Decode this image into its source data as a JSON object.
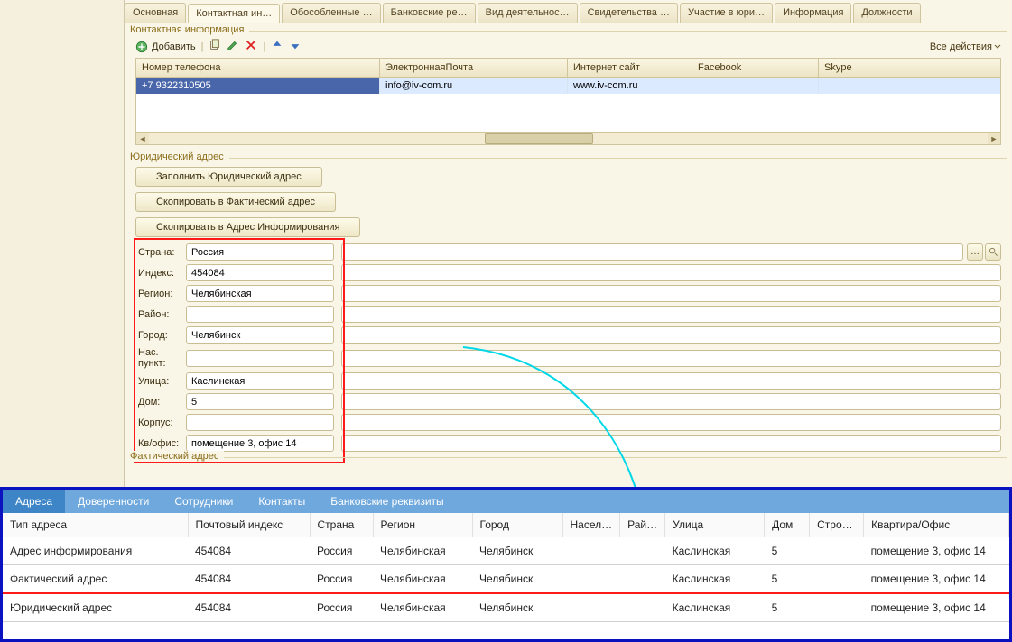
{
  "tabs": [
    "Основная",
    "Контактная ин…",
    "Обособленные …",
    "Банковские ре…",
    "Вид деятельнос…",
    "Свидетельства …",
    "Участие в юри…",
    "Информация",
    "Должности"
  ],
  "active_tab_index": 1,
  "contact_section_title": "Контактная информация",
  "toolbar": {
    "add_label": "Добавить",
    "all_actions_label": "Все действия"
  },
  "contact_table": {
    "headers": [
      "Номер телефона",
      "ЭлектроннаяПочта",
      "Интернет сайт",
      "Facebook",
      "Skype"
    ],
    "rows": [
      {
        "phone": "+7 9322310505",
        "email": "info@iv-com.ru",
        "site": "www.iv-com.ru",
        "fb": "",
        "skype": ""
      }
    ]
  },
  "legal_address_title": "Юридический адрес",
  "buttons": {
    "fill_legal": "Заполнить Юридический адрес",
    "copy_to_actual": "Скопировать в Фактический адрес",
    "copy_to_inform": "Скопировать в Адрес Информирования"
  },
  "address": {
    "country_label": "Страна:",
    "country": "Россия",
    "index_label": "Индекс:",
    "index": "454084",
    "region_label": "Регион:",
    "region": "Челябинская",
    "district_label": "Район:",
    "district": "",
    "city_label": "Город:",
    "city": "Челябинск",
    "locality_label": "Нас. пункт:",
    "locality": "",
    "street_label": "Улица:",
    "street": "Каслинская",
    "house_label": "Дом:",
    "house": "5",
    "building_label": "Корпус:",
    "building": "",
    "flat_label": "Кв/офис:",
    "flat": "помещение 3, офис 14"
  },
  "actual_address_title": "Фактический адрес",
  "bottom_tabs": [
    "Адреса",
    "Доверенности",
    "Сотрудники",
    "Контакты",
    "Банковские реквизиты"
  ],
  "bottom_active_tab_index": 0,
  "bottom_table": {
    "headers": [
      "Тип адреса",
      "Почтовый индекс",
      "Страна",
      "Регион",
      "Город",
      "Насел…",
      "Рай…",
      "Улица",
      "Дом",
      "Стро…",
      "Квартира/Офис"
    ],
    "rows": [
      {
        "type": "Адрес информирования",
        "index": "454084",
        "country": "Россия",
        "region": "Челябинская",
        "city": "Челябинск",
        "loc": "",
        "dist": "",
        "street": "Каслинская",
        "house": "5",
        "bld": "",
        "flat": "помещение 3, офис 14"
      },
      {
        "type": "Фактический адрес",
        "index": "454084",
        "country": "Россия",
        "region": "Челябинская",
        "city": "Челябинск",
        "loc": "",
        "dist": "",
        "street": "Каслинская",
        "house": "5",
        "bld": "",
        "flat": "помещение 3, офис 14"
      },
      {
        "type": "Юридический адрес",
        "index": "454084",
        "country": "Россия",
        "region": "Челябинская",
        "city": "Челябинск",
        "loc": "",
        "dist": "",
        "street": "Каслинская",
        "house": "5",
        "bld": "",
        "flat": "помещение 3, офис 14"
      }
    ]
  }
}
